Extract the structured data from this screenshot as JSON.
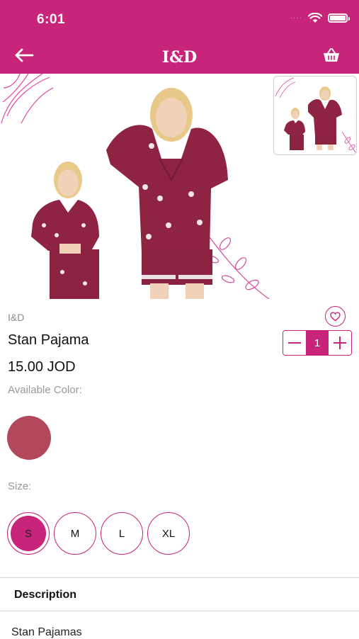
{
  "status": {
    "time": "6:01",
    "signal": "····"
  },
  "nav": {
    "title": "I&D"
  },
  "product": {
    "brand": "I&D",
    "name": "Stan Pajama",
    "price": "15.00 JOD",
    "quantity": "1"
  },
  "colors": {
    "label": "Available Color:",
    "swatch": "#b2485c",
    "accent": "#c8247a"
  },
  "sizes": {
    "label": "Size:",
    "options": [
      "S",
      "M",
      "L",
      "XL"
    ],
    "selected": "S"
  },
  "description": {
    "title": "Description",
    "text": "Stan Pajamas"
  }
}
